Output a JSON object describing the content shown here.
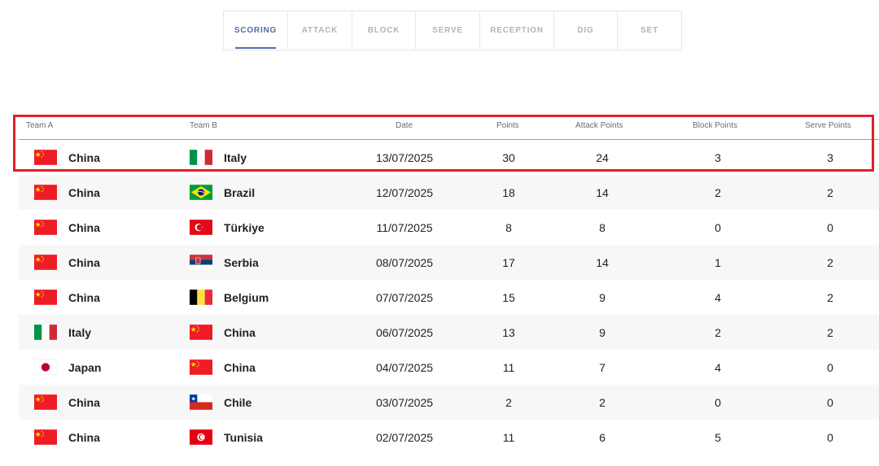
{
  "tabs": [
    {
      "label": "SCORING",
      "active": true
    },
    {
      "label": "ATTACK",
      "active": false
    },
    {
      "label": "BLOCK",
      "active": false
    },
    {
      "label": "SERVE",
      "active": false
    },
    {
      "label": "RECEPTION",
      "active": false
    },
    {
      "label": "DIG",
      "active": false
    },
    {
      "label": "SET",
      "active": false
    }
  ],
  "table": {
    "headers": {
      "team_a": "Team A",
      "team_b": "Team B",
      "date": "Date",
      "points": "Points",
      "attack_points": "Attack Points",
      "block_points": "Block Points",
      "serve_points": "Serve Points"
    },
    "rows": [
      {
        "team_a": "China",
        "flag_a": "china-flag-icon",
        "team_b": "Italy",
        "flag_b": "italy-flag-icon",
        "date": "13/07/2025",
        "points": "30",
        "attack": "24",
        "block": "3",
        "serve": "3"
      },
      {
        "team_a": "China",
        "flag_a": "china-flag-icon",
        "team_b": "Brazil",
        "flag_b": "brazil-flag-icon",
        "date": "12/07/2025",
        "points": "18",
        "attack": "14",
        "block": "2",
        "serve": "2"
      },
      {
        "team_a": "China",
        "flag_a": "china-flag-icon",
        "team_b": "Türkiye",
        "flag_b": "turkiye-flag-icon",
        "date": "11/07/2025",
        "points": "8",
        "attack": "8",
        "block": "0",
        "serve": "0"
      },
      {
        "team_a": "China",
        "flag_a": "china-flag-icon",
        "team_b": "Serbia",
        "flag_b": "serbia-flag-icon",
        "date": "08/07/2025",
        "points": "17",
        "attack": "14",
        "block": "1",
        "serve": "2"
      },
      {
        "team_a": "China",
        "flag_a": "china-flag-icon",
        "team_b": "Belgium",
        "flag_b": "belgium-flag-icon",
        "date": "07/07/2025",
        "points": "15",
        "attack": "9",
        "block": "4",
        "serve": "2"
      },
      {
        "team_a": "Italy",
        "flag_a": "italy-flag-icon",
        "team_b": "China",
        "flag_b": "china-flag-icon",
        "date": "06/07/2025",
        "points": "13",
        "attack": "9",
        "block": "2",
        "serve": "2"
      },
      {
        "team_a": "Japan",
        "flag_a": "japan-flag-icon",
        "team_b": "China",
        "flag_b": "china-flag-icon",
        "date": "04/07/2025",
        "points": "11",
        "attack": "7",
        "block": "4",
        "serve": "0"
      },
      {
        "team_a": "China",
        "flag_a": "china-flag-icon",
        "team_b": "Chile",
        "flag_b": "chile-flag-icon",
        "date": "03/07/2025",
        "points": "2",
        "attack": "2",
        "block": "0",
        "serve": "0"
      },
      {
        "team_a": "China",
        "flag_a": "china-flag-icon",
        "team_b": "Tunisia",
        "flag_b": "tunisia-flag-icon",
        "date": "02/07/2025",
        "points": "11",
        "attack": "6",
        "block": "5",
        "serve": "0"
      }
    ]
  },
  "colors": {
    "accent": "#4f6fa8",
    "highlight_border": "#e0202b"
  }
}
